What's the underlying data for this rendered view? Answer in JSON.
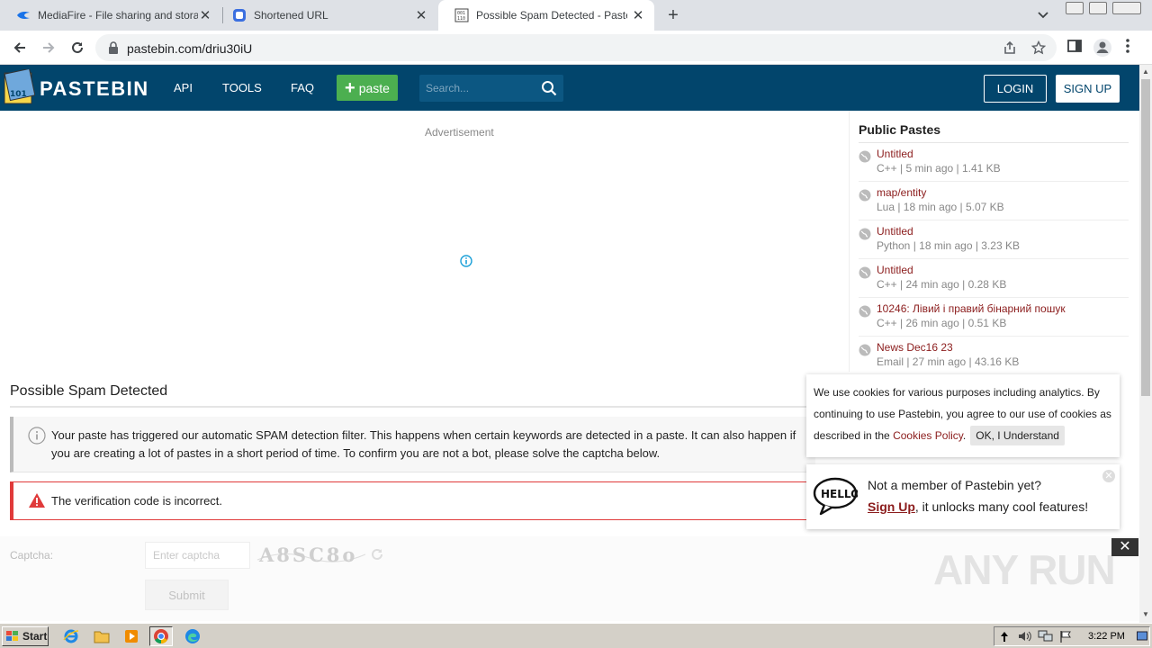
{
  "browser": {
    "tabs": [
      {
        "title": "MediaFire - File sharing and storage m",
        "active": false
      },
      {
        "title": "Shortened URL",
        "active": false
      },
      {
        "title": "Possible Spam Detected - Pastebin.com",
        "active": true
      }
    ],
    "url": "pastebin.com/driu30iU"
  },
  "header": {
    "brand": "PASTEBIN",
    "nav": [
      "API",
      "TOOLS",
      "FAQ"
    ],
    "paste_button": "paste",
    "search_placeholder": "Search...",
    "login": "LOGIN",
    "signup": "SIGN UP"
  },
  "main": {
    "ad_label": "Advertisement",
    "title": "Possible Spam Detected",
    "notice": "Your paste has triggered our automatic SPAM detection filter. This happens when certain keywords are detected in a paste. It can also happen if you are creating a lot of pastes in a short period of time. To confirm you are not a bot, please solve the captcha below.",
    "error": "The verification code is incorrect.",
    "captcha_label": "Captcha:",
    "captcha_placeholder": "Enter captcha",
    "captcha_code": "A8SC8o",
    "submit": "Submit"
  },
  "sidebar": {
    "title": "Public Pastes",
    "items": [
      {
        "title": "Untitled",
        "meta": "C++ | 5 min ago | 1.41 KB"
      },
      {
        "title": "map/entity",
        "meta": "Lua | 18 min ago | 5.07 KB"
      },
      {
        "title": "Untitled",
        "meta": "Python | 18 min ago | 3.23 KB"
      },
      {
        "title": "Untitled",
        "meta": "C++ | 24 min ago | 0.28 KB"
      },
      {
        "title": "10246: Лівий і правий бінарний пошук",
        "meta": "C++ | 26 min ago | 0.51 KB"
      },
      {
        "title": "News Dec16 23",
        "meta": "Email | 27 min ago | 43.16 KB"
      }
    ]
  },
  "cookie": {
    "text": "We use cookies for various purposes including analytics. By continuing to use Pastebin, you agree to our use of cookies as described in the",
    "link": "Cookies Policy",
    "after_link": ".",
    "button": "OK, I Understand"
  },
  "signup_popup": {
    "line1": "Not a member of Pastebin yet?",
    "link": "Sign Up",
    "line2_rest": ", it unlocks many cool features!"
  },
  "watermark": "ANY RUN",
  "taskbar": {
    "start": "Start",
    "clock": "3:22 PM"
  },
  "colors": {
    "header_bg": "#02456c",
    "paste_green": "#4caf50",
    "link_red": "#8b1c1c",
    "error_red": "#e03a3a"
  }
}
